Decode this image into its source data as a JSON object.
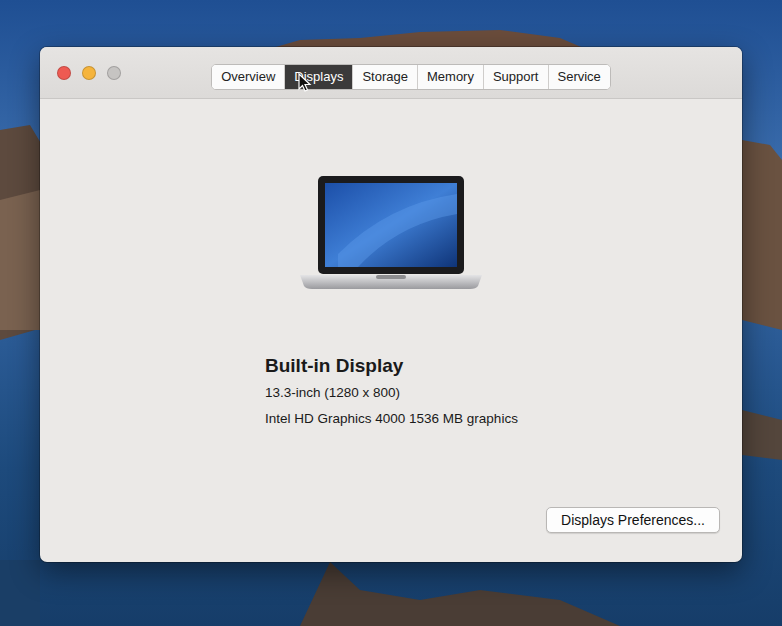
{
  "window": {
    "controls": [
      {
        "color": "#ee5a52"
      },
      {
        "color": "#f5b43c"
      },
      {
        "color": "#c6c4c2"
      }
    ]
  },
  "tabs": [
    {
      "label": "Overview",
      "selected": false
    },
    {
      "label": "Displays",
      "selected": true
    },
    {
      "label": "Storage",
      "selected": false
    },
    {
      "label": "Memory",
      "selected": false
    },
    {
      "label": "Support",
      "selected": false
    },
    {
      "label": "Service",
      "selected": false
    }
  ],
  "display": {
    "title": "Built-in Display",
    "size": "13.3-inch (1280 x 800)",
    "graphics": "Intel HD Graphics 4000 1536 MB graphics"
  },
  "buttons": [
    "Displays Preferences..."
  ]
}
